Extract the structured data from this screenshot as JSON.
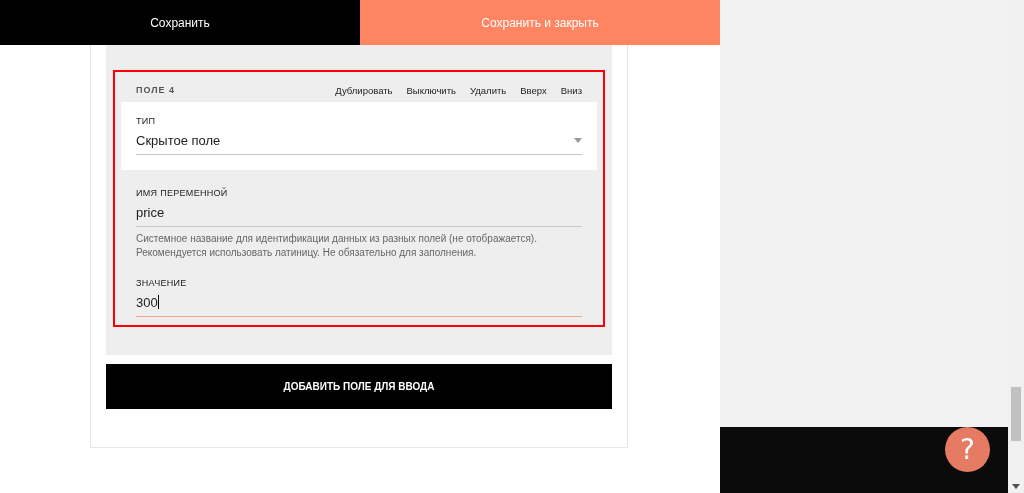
{
  "top_bar": {
    "buttons": [
      {
        "label": "Сохранить",
        "kind": "dark"
      },
      {
        "label": "Сохранить и закрыть",
        "kind": "accent"
      }
    ]
  },
  "field_block": {
    "title": "ПОЛЕ 4",
    "highlighted": true,
    "actions": [
      "Дублировать",
      "Выключить",
      "Удалить",
      "Вверх",
      "Вниз"
    ],
    "fields": [
      {
        "kind": "select",
        "label": "ТИП",
        "value": "Скрытое поле",
        "focused": false
      },
      {
        "kind": "text",
        "label": "ИМЯ ПЕРЕМЕННОЙ",
        "value": "price",
        "hint": "Системное название для идентификации данных из разных полей (не отображается). Рекомендуется использовать латиницу. Не обязательно для заполнения.",
        "focused": false
      },
      {
        "kind": "text",
        "label": "ЗНАЧЕНИЕ",
        "value": "300",
        "focused": true
      }
    ]
  },
  "add_button": {
    "label": "ДОБАВИТЬ ПОЛЕ ДЛЯ ВВОДА"
  },
  "help_button": {
    "label": "?"
  }
}
